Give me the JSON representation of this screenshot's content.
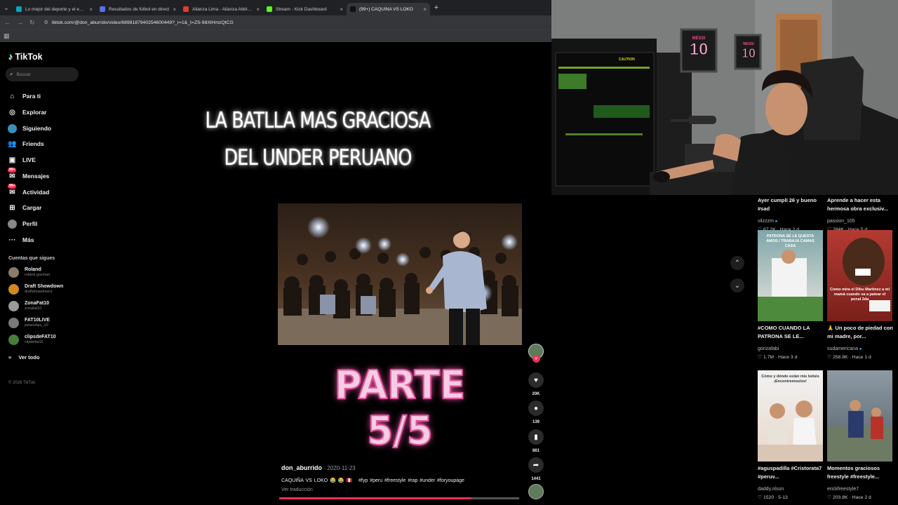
{
  "browser": {
    "tabs": [
      {
        "title": "Lo mejor del deporte y el entre",
        "color": "#0aa3c2",
        "active": false
      },
      {
        "title": "Resultados de fútbol en direct",
        "color": "#5a6cf0",
        "active": false
      },
      {
        "title": "Alianza Lima - Alianza Atlético",
        "color": "#e23b2e",
        "active": false
      },
      {
        "title": "Stream - Kick Dashboard",
        "color": "#53fc18",
        "active": false
      },
      {
        "title": "(99+) CAQUIÑA VS LOKO",
        "color": "#111111",
        "active": true
      }
    ],
    "url": "tiktok.com/@don_aburrido/video/6898187940254600449?_r=1&_t=ZS-98XlHmzQtCG"
  },
  "sidebar": {
    "brand": "TikTok",
    "search_placeholder": "Buscar",
    "nav": [
      {
        "label": "Para ti",
        "icon": "home-icon",
        "glyph": "⌂"
      },
      {
        "label": "Explorar",
        "icon": "compass-icon",
        "glyph": "◎"
      },
      {
        "label": "Siguiendo",
        "icon": "following-avatar-icon",
        "glyph": "●"
      },
      {
        "label": "Friends",
        "icon": "friends-icon",
        "glyph": "👥"
      },
      {
        "label": "LIVE",
        "icon": "live-icon",
        "glyph": "▣"
      },
      {
        "label": "Mensajes",
        "icon": "message-icon",
        "glyph": "✉",
        "badge": "99+"
      },
      {
        "label": "Actividad",
        "icon": "inbox-icon",
        "glyph": "✉",
        "badge": "99+"
      },
      {
        "label": "Cargar",
        "icon": "upload-icon",
        "glyph": "⊞"
      },
      {
        "label": "Perfil",
        "icon": "profile-avatar-icon",
        "glyph": "●"
      },
      {
        "label": "Más",
        "icon": "more-icon",
        "glyph": "···"
      }
    ],
    "following_title": "Cuentas que sigues",
    "following": [
      {
        "name": "Roland",
        "handle": "roland.gozman",
        "color": "#8c7b6b"
      },
      {
        "name": "Draft Showdown",
        "handle": "draftshowdown1",
        "color": "#d08a1d"
      },
      {
        "name": "ZonaFat10",
        "handle": "zonafat10",
        "color": "#9a9a9a"
      },
      {
        "name": "FAT10LIVE",
        "handle": "pelaoclips_10",
        "color": "#7a7a7a"
      },
      {
        "name": "clipsdeFAT10",
        "handle": "clipdefat10",
        "color": "#4b7d3a"
      }
    ],
    "see_all": "Ver todo",
    "copyright": "© 2026 TikTok"
  },
  "video": {
    "title_line1": "LA BATLLA MAS GRACIOSA",
    "title_line2": "DEL UNDER PERUANO",
    "overlay": "PARTE 5/5",
    "author": "don_aburrido",
    "date": "2020-11-23",
    "caption": "CAQUIÑA VS LOKO 😂 😂 🇵🇪",
    "hashtags": "#fyp #peru #freestyle #rap #under #foryoupage",
    "translate": "Ver traducción",
    "progress": 0.8,
    "likes": "20K",
    "comments": "139",
    "saves": "861",
    "shares": "1441"
  },
  "webcam": {
    "jersey1_name": "MESSI",
    "jersey1_number": "10",
    "jersey2_name": "MESSI",
    "jersey2_number": "10",
    "caution": "CAUTION"
  },
  "recommendations": [
    {
      "title": "Ayer cumplí 26 y bueno #sad",
      "user": "vilzzzm",
      "likes": "67.2K",
      "ago": "Hace 2 d",
      "verified": true
    },
    {
      "title": "Aprende a hacer esta hermosa obra exclusiv...",
      "user": "passion_105",
      "likes": "284K",
      "ago": "Hace 5 d",
      "verified": false
    },
    {
      "title": "#COMO CUANDO LA PATRONA SE LE...",
      "user": "gonzafabi",
      "likes": "1.7M",
      "ago": "Hace 3 d",
      "verified": false,
      "overlay": "PATRONA SE LE QUESTA AMOS / TRABAJA CAMAS CASA"
    },
    {
      "title": "🙏 Un poco de piedad con mi madre, por...",
      "user": "sudamericana",
      "likes": "258.8K",
      "ago": "Hace 1 d",
      "verified": true,
      "overlay": "Como mira el Dibu Martínez a mi mamá cuando va a patear el penal 2da"
    },
    {
      "title": "#aguspadilla #Cristorata7 #peruv...",
      "user": "daddy.nlson",
      "likes": "1520",
      "ago": "5-13",
      "verified": false,
      "overlay": "Cómo y dónde están mis bebés ¡Encontremoslos!"
    },
    {
      "title": "Momentos graciosos freestyle #freestyle...",
      "user": "erickfreestyle7",
      "likes": "203.8K",
      "ago": "Hace 2 d",
      "verified": false
    }
  ]
}
